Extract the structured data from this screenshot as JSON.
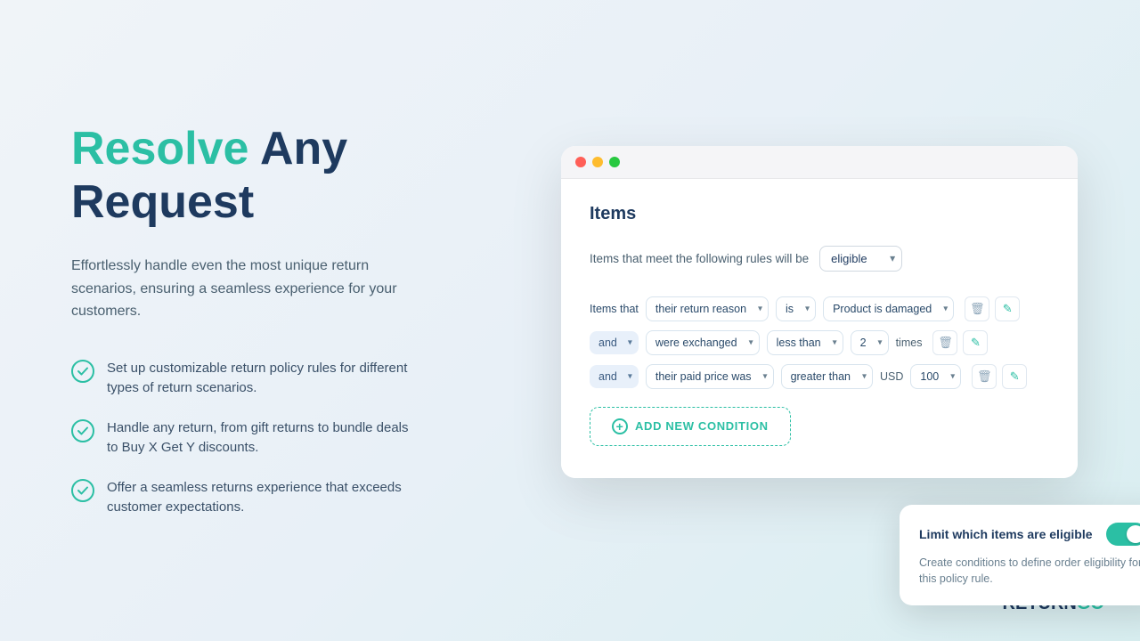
{
  "hero": {
    "title_highlight": "Resolve",
    "title_dark": "Any\nRequest",
    "description": "Effortlessly handle even the most unique return scenarios, ensuring a seamless experience for your customers.",
    "features": [
      "Set up customizable return policy rules for different types of return scenarios.",
      "Handle any return, from gift returns to bundle deals to Buy X Get Y discounts.",
      "Offer a seamless returns experience that exceeds customer expectations."
    ]
  },
  "window": {
    "section": "Items",
    "eligible_label": "Items that meet the following rules will be",
    "eligible_value": "eligible",
    "condition_rows": [
      {
        "prefix": "Items that",
        "field1": "their return reason",
        "field2": "is",
        "field3": "Product is damaged"
      },
      {
        "prefix": "and",
        "has_dropdown": true,
        "field1": "were exchanged",
        "field2": "less than",
        "field3": "2",
        "suffix": "times"
      },
      {
        "prefix": "and",
        "has_dropdown": true,
        "field1": "their paid price was",
        "field2": "greater than",
        "currency": "USD",
        "field3": "100"
      }
    ],
    "add_button": "ADD NEW CONDITION"
  },
  "info_card": {
    "title": "Limit which items are eligible",
    "description": "Create conditions to define order eligibility for this policy rule."
  },
  "logo": {
    "text_dark": "RETURN",
    "text_green": "GO"
  }
}
